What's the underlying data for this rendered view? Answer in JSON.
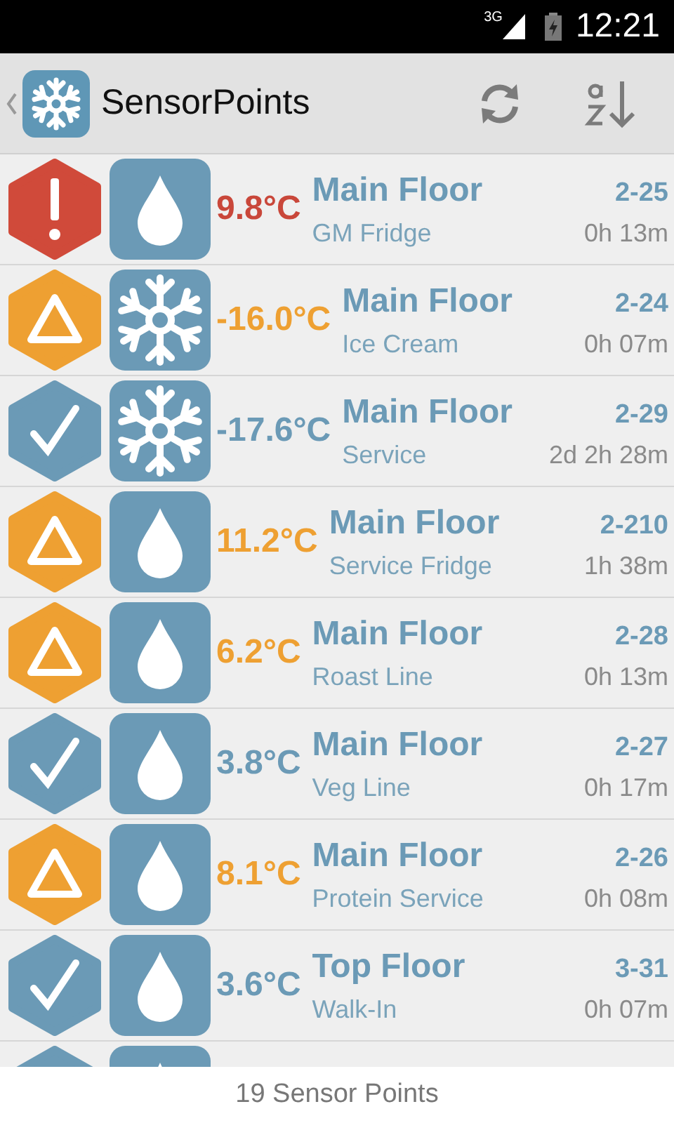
{
  "status_bar": {
    "network": "3G",
    "time": "12:21"
  },
  "action_bar": {
    "title": "SensorPoints"
  },
  "sensors": [
    {
      "alarm": true,
      "warning": false,
      "kind": "chilled",
      "temperature": "9.8°C",
      "area": "Main Floor",
      "name": "GM Fridge",
      "code": "2-25",
      "age": "0h 13m"
    },
    {
      "alarm": false,
      "warning": true,
      "kind": "frozen",
      "temperature": "-16.0°C",
      "area": "Main Floor",
      "name": "Ice Cream",
      "code": "2-24",
      "age": "0h 07m"
    },
    {
      "alarm": false,
      "warning": false,
      "kind": "frozen",
      "temperature": "-17.6°C",
      "area": "Main Floor",
      "name": "Service",
      "code": "2-29",
      "age": "2d 2h 28m"
    },
    {
      "alarm": false,
      "warning": true,
      "kind": "chilled",
      "temperature": "11.2°C",
      "area": "Main Floor",
      "name": "Service Fridge",
      "code": "2-210",
      "age": "1h 38m"
    },
    {
      "alarm": false,
      "warning": true,
      "kind": "chilled",
      "temperature": "6.2°C",
      "area": "Main Floor",
      "name": "Roast Line",
      "code": "2-28",
      "age": "0h 13m"
    },
    {
      "alarm": false,
      "warning": false,
      "kind": "chilled",
      "temperature": "3.8°C",
      "area": "Main Floor",
      "name": "Veg Line",
      "code": "2-27",
      "age": "0h 17m"
    },
    {
      "alarm": false,
      "warning": true,
      "kind": "chilled",
      "temperature": "8.1°C",
      "area": "Main Floor",
      "name": "Protein Service",
      "code": "2-26",
      "age": "0h 08m"
    },
    {
      "alarm": false,
      "warning": false,
      "kind": "chilled",
      "temperature": "3.6°C",
      "area": "Top Floor",
      "name": "Walk-In",
      "code": "3-31",
      "age": "0h 07m"
    },
    {
      "alarm": false,
      "warning": false,
      "kind": "chilled"
    }
  ],
  "footer": {
    "count": "19 Sensor Points"
  }
}
